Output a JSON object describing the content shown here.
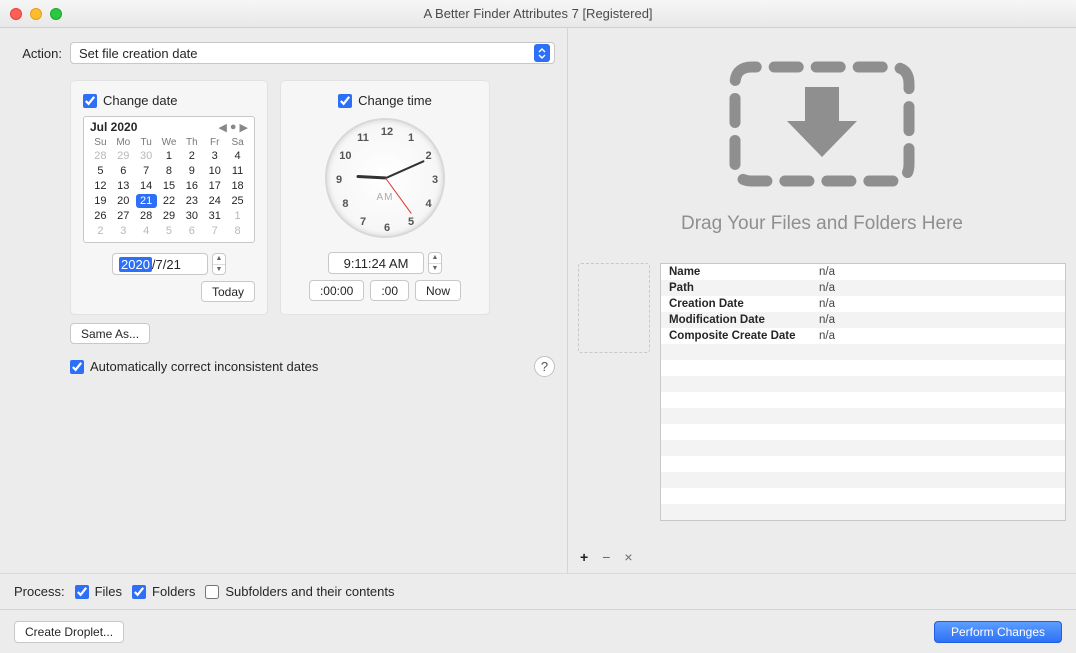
{
  "title": "A Better Finder Attributes 7 [Registered]",
  "action": {
    "label": "Action:",
    "value": "Set file creation date"
  },
  "changeDate": {
    "label": "Change date",
    "monthYear": "Jul 2020",
    "dayHeaders": [
      "Su",
      "Mo",
      "Tu",
      "We",
      "Th",
      "Fr",
      "Sa"
    ],
    "cells": [
      {
        "t": "28",
        "out": true
      },
      {
        "t": "29",
        "out": true
      },
      {
        "t": "30",
        "out": true
      },
      {
        "t": "1"
      },
      {
        "t": "2"
      },
      {
        "t": "3"
      },
      {
        "t": "4"
      },
      {
        "t": "5"
      },
      {
        "t": "6"
      },
      {
        "t": "7"
      },
      {
        "t": "8"
      },
      {
        "t": "9"
      },
      {
        "t": "10"
      },
      {
        "t": "11"
      },
      {
        "t": "12"
      },
      {
        "t": "13"
      },
      {
        "t": "14"
      },
      {
        "t": "15"
      },
      {
        "t": "16"
      },
      {
        "t": "17"
      },
      {
        "t": "18"
      },
      {
        "t": "19"
      },
      {
        "t": "20"
      },
      {
        "t": "21",
        "sel": true
      },
      {
        "t": "22"
      },
      {
        "t": "23"
      },
      {
        "t": "24"
      },
      {
        "t": "25"
      },
      {
        "t": "26"
      },
      {
        "t": "27"
      },
      {
        "t": "28"
      },
      {
        "t": "29"
      },
      {
        "t": "30"
      },
      {
        "t": "31"
      },
      {
        "t": "1",
        "out": true
      },
      {
        "t": "2",
        "out": true
      },
      {
        "t": "3",
        "out": true
      },
      {
        "t": "4",
        "out": true
      },
      {
        "t": "5",
        "out": true
      },
      {
        "t": "6",
        "out": true
      },
      {
        "t": "7",
        "out": true
      },
      {
        "t": "8",
        "out": true
      }
    ],
    "yearField": "2020",
    "mdField": "7/21",
    "todayBtn": "Today"
  },
  "changeTime": {
    "label": "Change time",
    "ampm": "AM",
    "timeField": "9:11:24 AM",
    "zeroSecBtn": ":00:00",
    "zeroBtn": ":00",
    "nowBtn": "Now",
    "hourAngle": 273,
    "minAngle": 66,
    "secAngle": 144
  },
  "sameAs": "Same As...",
  "autoCorrect": "Automatically correct inconsistent dates",
  "drop": {
    "caption": "Drag Your Files and Folders Here"
  },
  "info": [
    {
      "k": "Name",
      "v": "n/a"
    },
    {
      "k": "Path",
      "v": "n/a"
    },
    {
      "k": "Creation Date",
      "v": "n/a"
    },
    {
      "k": "Modification Date",
      "v": "n/a"
    },
    {
      "k": "Composite Create Date",
      "v": "n/a"
    }
  ],
  "process": {
    "label": "Process:",
    "files": "Files",
    "folders": "Folders",
    "subfolders": "Subfolders and their contents"
  },
  "footer": {
    "createDroplet": "Create Droplet...",
    "perform": "Perform Changes"
  }
}
